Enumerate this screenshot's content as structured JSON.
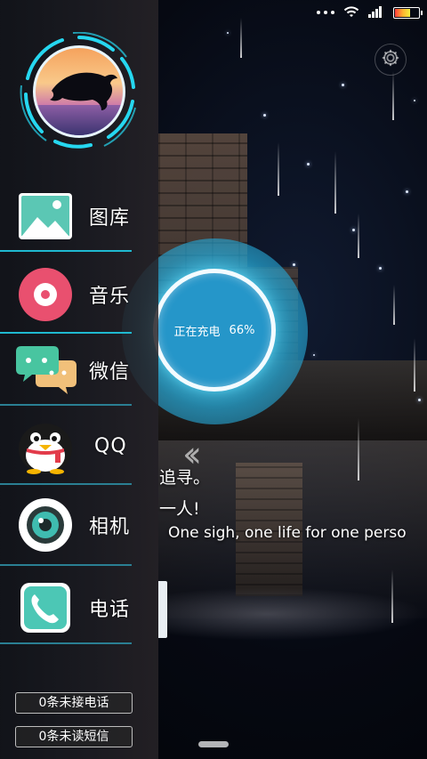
{
  "status_bar": {
    "signal_icon": "signal-bars-icon",
    "wifi_icon": "wifi-icon",
    "battery_icon": "battery-icon",
    "battery_level": 0.66
  },
  "settings": {
    "icon": "gear-icon"
  },
  "sidebar": {
    "avatar_icon": "dolphin-sunset-avatar",
    "items": [
      {
        "label": "图库",
        "icon": "gallery-icon"
      },
      {
        "label": "音乐",
        "icon": "music-disc-icon"
      },
      {
        "label": "微信",
        "icon": "wechat-icon"
      },
      {
        "label": "QQ",
        "icon": "qq-penguin-icon"
      },
      {
        "label": "相机",
        "icon": "camera-icon"
      },
      {
        "label": "电话",
        "icon": "phone-icon"
      }
    ],
    "missed_calls": "0条未接电话",
    "unread_sms": "0条未读短信"
  },
  "charging": {
    "status_text": "正在充电",
    "percent_text": "66%",
    "percent": 66
  },
  "quote": {
    "line1": "追寻。",
    "line2": "一人!",
    "line3": "One sigh, one life for one perso"
  },
  "colors": {
    "accent_cyan": "#1fb9d0",
    "charge_blue": "#2596c9"
  }
}
